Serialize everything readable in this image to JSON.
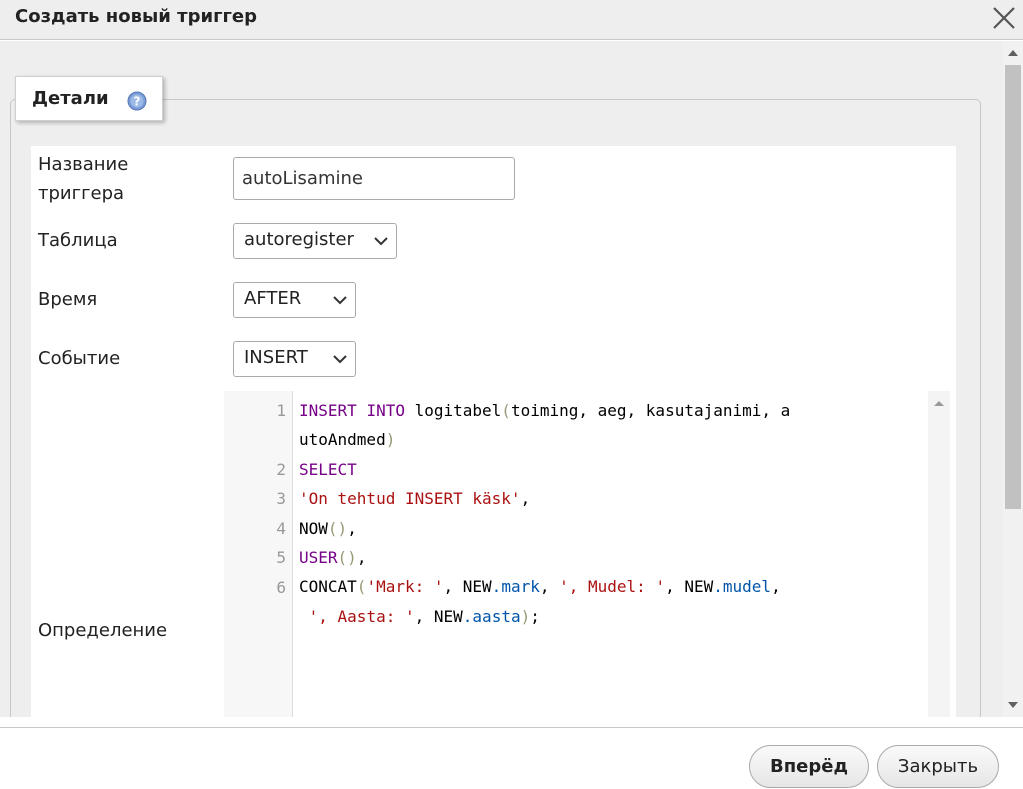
{
  "dialog": {
    "title": "Создать новый триггер"
  },
  "details": {
    "legend": "Детали"
  },
  "form": {
    "name_label": "Название триггера",
    "name_value": "autoLisamine",
    "table_label": "Таблица",
    "table_value": "autoregister",
    "time_label": "Время",
    "time_value": "AFTER",
    "event_label": "Событие",
    "event_value": "INSERT",
    "definition_label": "Определение"
  },
  "editor": {
    "line_numbers": [
      "1",
      "2",
      "3",
      "4",
      "5",
      "6"
    ],
    "lines": [
      "INSERT INTO logitabel(toiming, aeg, kasutajanimi, autoAndmed)",
      "SELECT",
      "'On tehtud INSERT käsk',",
      "NOW(),",
      "USER(),",
      "CONCAT('Mark: ', NEW.mark, ', Mudel: ', NEW.mudel, ', Aasta: ', NEW.aasta);"
    ]
  },
  "footer": {
    "go_label": "Вперёд",
    "close_label": "Закрыть"
  },
  "icons": {
    "close": "close-icon",
    "help": "help-icon",
    "dropdown": "chevron-down-icon"
  }
}
